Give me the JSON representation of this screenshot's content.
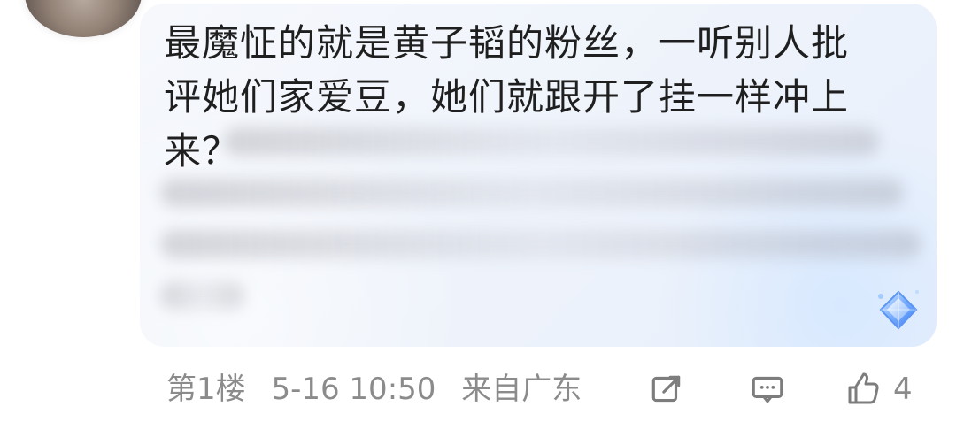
{
  "comment": {
    "visible_text": "最魔怔的就是黄子韬的粉丝，一听别人批\n评她们家爱豆，她们就跟开了挂一样冲上\n来？"
  },
  "meta": {
    "floor": "第1楼",
    "datetime": "5-16 10:50",
    "location": "来自广东"
  },
  "actions": {
    "share_icon": "share-icon",
    "comment_icon": "comment-icon",
    "like_icon": "like-icon",
    "like_count": "4"
  },
  "decor": {
    "badge_icon": "diamond-badge-icon",
    "accent": "#4f8ff2",
    "muted": "#8b8b8b"
  }
}
